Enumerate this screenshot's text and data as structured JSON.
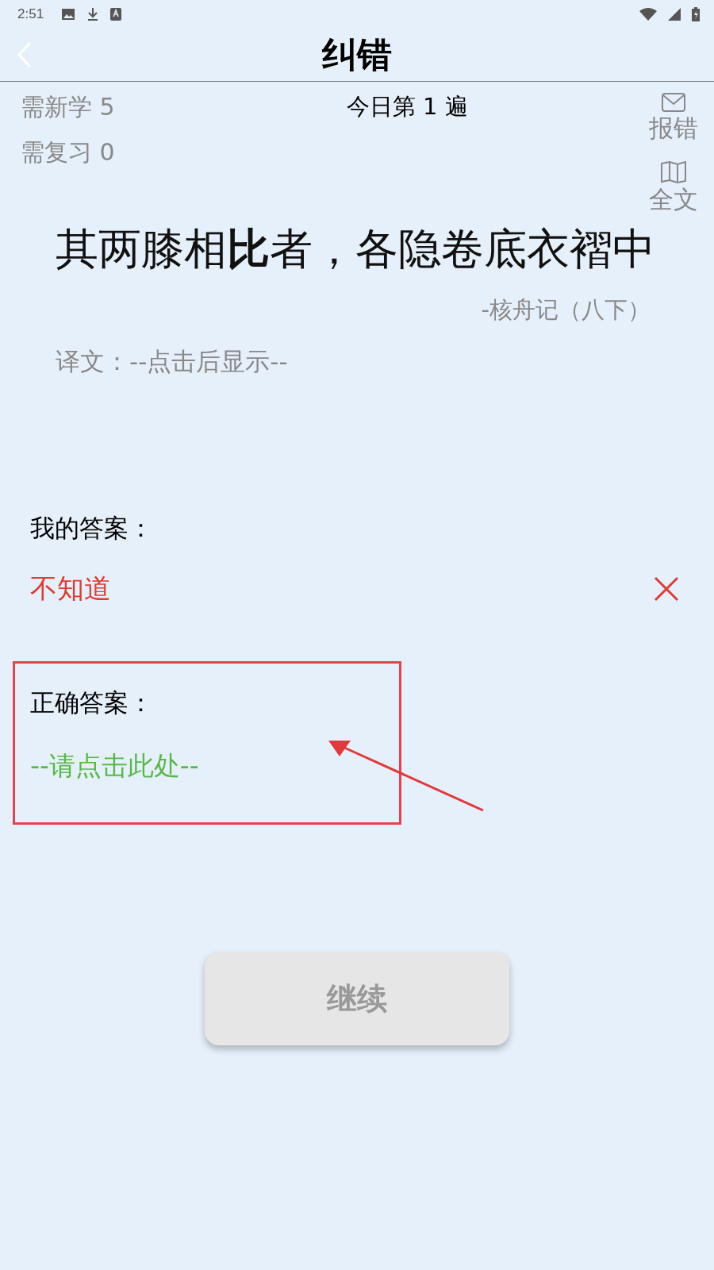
{
  "status_bar": {
    "time": "2:51"
  },
  "header": {
    "title": "纠错"
  },
  "stats": [
    "需新学 5",
    "需复习 0"
  ],
  "progress": "今日第 1 遍",
  "side_actions": [
    {
      "label": "报错",
      "kind": "mail"
    },
    {
      "label": "全文",
      "kind": "book"
    }
  ],
  "sentence": "其两膝相**比**者，各隐卷底衣褶中",
  "source": "-核舟记（八下）",
  "translation": "译文：--点击后显示--",
  "my_answer": {
    "label": "我的答案：",
    "value": "不知道",
    "correct": false
  },
  "correct_answer": {
    "label": "正确答案：",
    "value": "--请点击此处--"
  },
  "continue_button": {
    "label": "继续",
    "disabled": true
  }
}
